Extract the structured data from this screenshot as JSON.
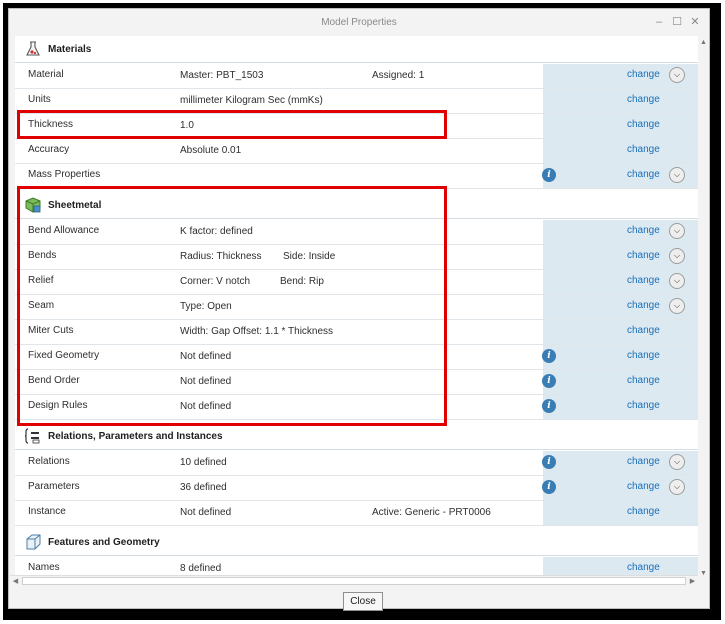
{
  "window": {
    "title": "Model Properties"
  },
  "sections": {
    "materials": {
      "title": "Materials",
      "rows": {
        "material": {
          "label": "Material",
          "value": "Master: PBT_1503",
          "value2": "Assigned: 1",
          "action": "change"
        },
        "units": {
          "label": "Units",
          "value": "millimeter Kilogram Sec (mmKs)",
          "action": "change"
        },
        "thickness": {
          "label": "Thickness",
          "value": "1.0",
          "action": "change"
        },
        "accuracy": {
          "label": "Accuracy",
          "value": "Absolute 0.01",
          "action": "change"
        },
        "mass": {
          "label": "Mass Properties",
          "action": "change"
        }
      }
    },
    "sheetmetal": {
      "title": "Sheetmetal",
      "rows": {
        "bend_allowance": {
          "label": "Bend Allowance",
          "value": "K factor: defined",
          "action": "change"
        },
        "bends": {
          "label": "Bends",
          "value": "Radius: Thickness",
          "value2": "Side: Inside",
          "action": "change"
        },
        "relief": {
          "label": "Relief",
          "value": "Corner: V notch",
          "value2": "Bend: Rip",
          "action": "change"
        },
        "seam": {
          "label": "Seam",
          "value": "Type: Open",
          "action": "change"
        },
        "miter": {
          "label": "Miter Cuts",
          "value": "Width: Gap Offset: 1.1 * Thickness",
          "action": "change"
        },
        "fixed": {
          "label": "Fixed Geometry",
          "value": "Not defined",
          "action": "change"
        },
        "bend_order": {
          "label": "Bend Order",
          "value": "Not defined",
          "action": "change"
        },
        "design_rules": {
          "label": "Design Rules",
          "value": "Not defined",
          "action": "change"
        }
      }
    },
    "relations": {
      "title": "Relations, Parameters and Instances",
      "rows": {
        "relations": {
          "label": "Relations",
          "value": "10 defined",
          "action": "change"
        },
        "parameters": {
          "label": "Parameters",
          "value": "36 defined",
          "action": "change"
        },
        "instance": {
          "label": "Instance",
          "value": "Not defined",
          "value2": "Active: Generic - PRT0006",
          "action": "change"
        }
      }
    },
    "features": {
      "title": "Features and Geometry",
      "rows": {
        "names": {
          "label": "Names",
          "value": "8 defined",
          "action": "change"
        }
      }
    }
  },
  "footer": {
    "close_label": "Close"
  },
  "icons": {
    "info": "i",
    "expand": "v"
  },
  "colors": {
    "link": "#1a6fb8",
    "highlight": "#e00000",
    "row_accent": "#dde9f1"
  }
}
